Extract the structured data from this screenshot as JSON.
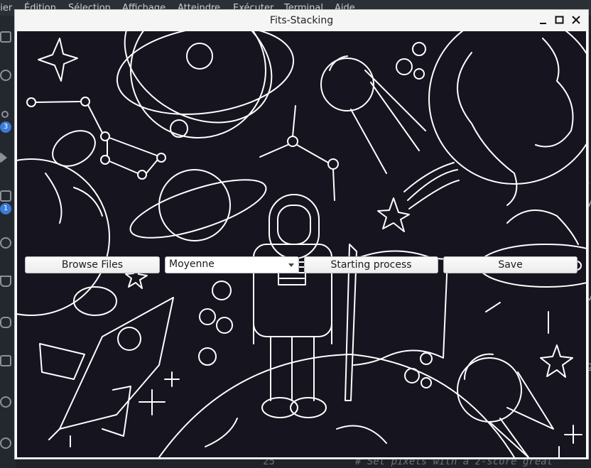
{
  "ide": {
    "menu": [
      "hier",
      "Édition",
      "Sélection",
      "Affichage",
      "Atteindre",
      "Exécuter",
      "Terminal",
      "Aide"
    ],
    "badges": [
      "3",
      "1"
    ],
    "right_glyphs": [
      ",",
      "i",
      "y",
      "v",
      "g",
      "l"
    ],
    "line_number": "25",
    "code_comment": "# Set pixels with a z-score great"
  },
  "window": {
    "title": "Fits-Stacking",
    "minimize_glyph": "–",
    "maximize_glyph": "□",
    "close_glyph": "✕"
  },
  "toolbar": {
    "browse_label": "Browse Files",
    "method_value": "Moyenne",
    "start_label": "Starting process",
    "save_label": "Save"
  },
  "colors": {
    "canvas_bg": "#15141f",
    "line_art": "#ffffff",
    "ide_bg": "#1f2329"
  }
}
